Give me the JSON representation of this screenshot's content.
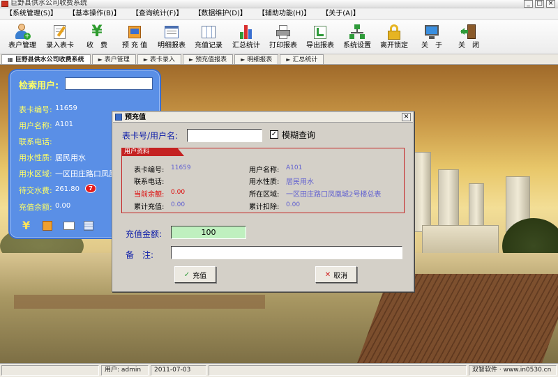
{
  "window": {
    "title": "巨野县供水公司收费系统"
  },
  "menu": [
    "【系统管理(S)】",
    "【基本操作(B)】",
    "【查询统计(F)】",
    "【数据维护(D)】",
    "【辅助功能(H)】",
    "【关于(A)】"
  ],
  "toolbar": [
    {
      "label": "表户管理",
      "icon": "user-add-icon"
    },
    {
      "label": "录入表卡",
      "icon": "card-edit-icon"
    },
    {
      "label": "收　费",
      "icon": "yen-icon"
    },
    {
      "label": "预 充 值",
      "icon": "prepay-icon"
    },
    {
      "label": "明细报表",
      "icon": "report-icon"
    },
    {
      "label": "充值记录",
      "icon": "table-icon"
    },
    {
      "label": "汇总统计",
      "icon": "bar-chart-icon"
    },
    {
      "label": "打印报表",
      "icon": "printer-icon"
    },
    {
      "label": "导出报表",
      "icon": "export-icon"
    },
    {
      "label": "系统设置",
      "icon": "network-icon"
    },
    {
      "label": "离开锁定",
      "icon": "lock-icon"
    },
    {
      "label": "关　于",
      "icon": "monitor-icon"
    },
    {
      "label": "关　闭",
      "icon": "exit-icon"
    }
  ],
  "tabs": [
    "巨野县供水公司收费系统",
    "表户管理",
    "表卡录入",
    "预充值报表",
    "明细报表",
    "汇总统计"
  ],
  "sidebar": {
    "search_label": "检索用户:",
    "fields": [
      {
        "label": "表卡编号:",
        "value": "11659"
      },
      {
        "label": "用户名称:",
        "value": "A101"
      },
      {
        "label": "联系电话:",
        "value": ""
      },
      {
        "label": "用水性质:",
        "value": "居民用水"
      },
      {
        "label": "用水区域:",
        "value": "一区田庄路口凤凰"
      },
      {
        "label": "待交水费:",
        "value": "261.80"
      },
      {
        "label": "充值余额:",
        "value": "0.00"
      }
    ],
    "badge": "7"
  },
  "dialog": {
    "title": "预充值",
    "card_label": "表卡号/用户名:",
    "card_value": "",
    "fuzzy_label": "模糊查询",
    "fuzzy_checked": true,
    "info_title": "用户资料",
    "info": {
      "card_no_label": "表卡编号:",
      "card_no": "11659",
      "name_label": "用户名称:",
      "name": "A101",
      "phone_label": "联系电话:",
      "phone": "",
      "nature_label": "用水性质:",
      "nature": "居民用水",
      "balance_label": "当前余额:",
      "balance": "0.00",
      "area_label": "所在区域:",
      "area": "一区田庄路口凤凰城2号楼总表",
      "total_charge_label": "累计充值:",
      "total_charge": "0.00",
      "total_deduct_label": "累计扣除:",
      "total_deduct": "0.00"
    },
    "amount_label": "充值金额:",
    "amount": "100",
    "note_label": "备　注:",
    "note": "",
    "ok_label": "充值",
    "cancel_label": "取消"
  },
  "status": {
    "user_label": "用户: admin",
    "date": "2011-07-03",
    "vendor": "双智软件 · www.in0530.cn"
  }
}
